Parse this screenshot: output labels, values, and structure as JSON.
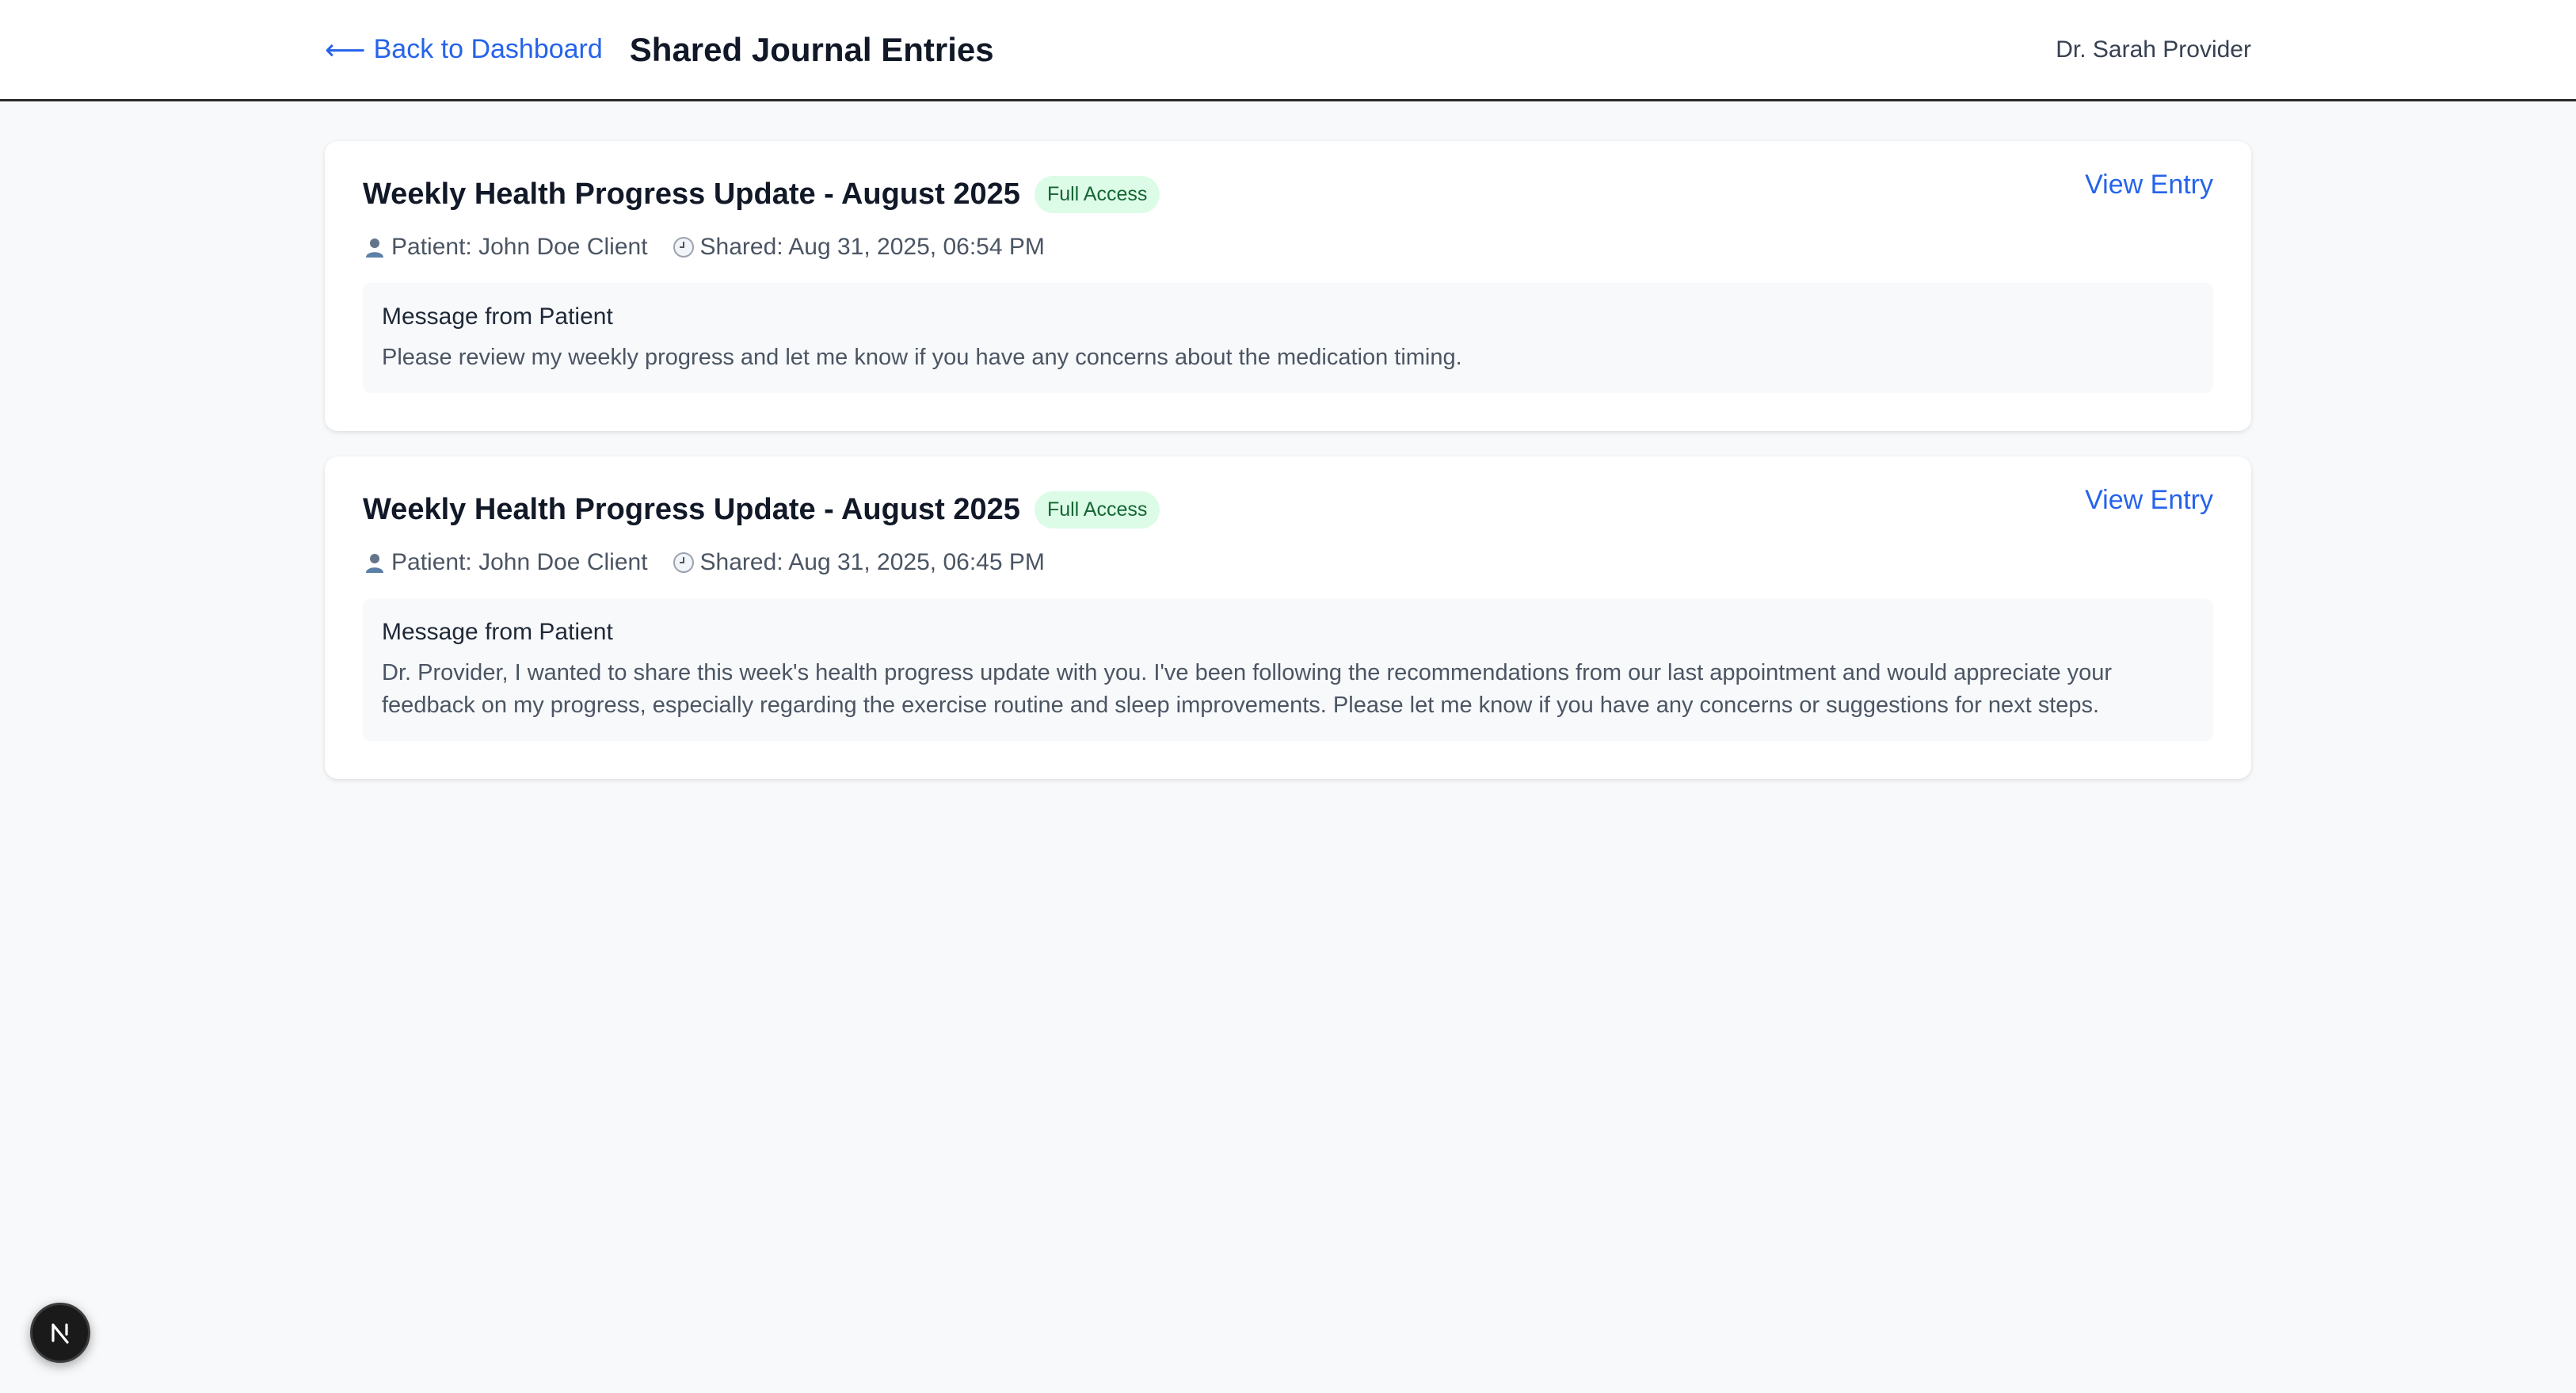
{
  "header": {
    "back_label": "Back to Dashboard",
    "back_arrow": "⟵",
    "title": "Shared Journal Entries",
    "user": "Dr. Sarah Provider"
  },
  "entries": [
    {
      "title": "Weekly Health Progress Update - August 2025",
      "badge": "Full Access",
      "view_label": "View Entry",
      "patient": "Patient: John Doe Client",
      "shared": "Shared: Aug 31, 2025, 06:54 PM",
      "message_label": "Message from Patient",
      "message": "Please review my weekly progress and let me know if you have any concerns about the medication timing."
    },
    {
      "title": "Weekly Health Progress Update - August 2025",
      "badge": "Full Access",
      "view_label": "View Entry",
      "patient": "Patient: John Doe Client",
      "shared": "Shared: Aug 31, 2025, 06:45 PM",
      "message_label": "Message from Patient",
      "message": "Dr. Provider, I wanted to share this week's health progress update with you. I've been following the recommendations from our last appointment and would appreciate your feedback on my progress, especially regarding the exercise routine and sleep improvements. Please let me know if you have any concerns or suggestions for next steps."
    }
  ],
  "colors": {
    "link": "#2563eb",
    "badge_bg": "#dcfce7",
    "badge_text": "#166534",
    "page_bg": "#f8f9fb"
  },
  "icons": {
    "patient": "person-icon",
    "shared": "clock-icon",
    "dev_badge": "nextjs-logo-icon"
  }
}
